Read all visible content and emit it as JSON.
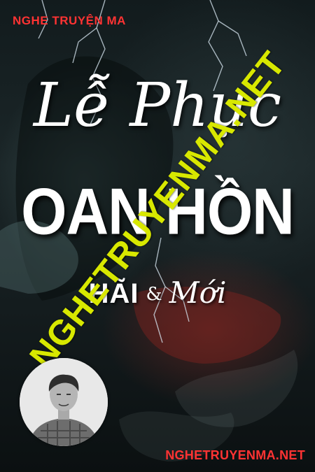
{
  "site_top_label": "NGHE TRUYỆN MA",
  "title": {
    "line1": "Lễ Phục",
    "line2": "OAN HỒN"
  },
  "authors": {
    "first": "HÃI",
    "separator": "&",
    "second": "Mới"
  },
  "watermark": "NGHETRUYENMA.NET",
  "site_bottom_label": "NGHETRUYENMA.NET",
  "colors": {
    "label_red": "#ff3333",
    "watermark_yellow": "#d8e800",
    "title_white": "#ffffff"
  }
}
